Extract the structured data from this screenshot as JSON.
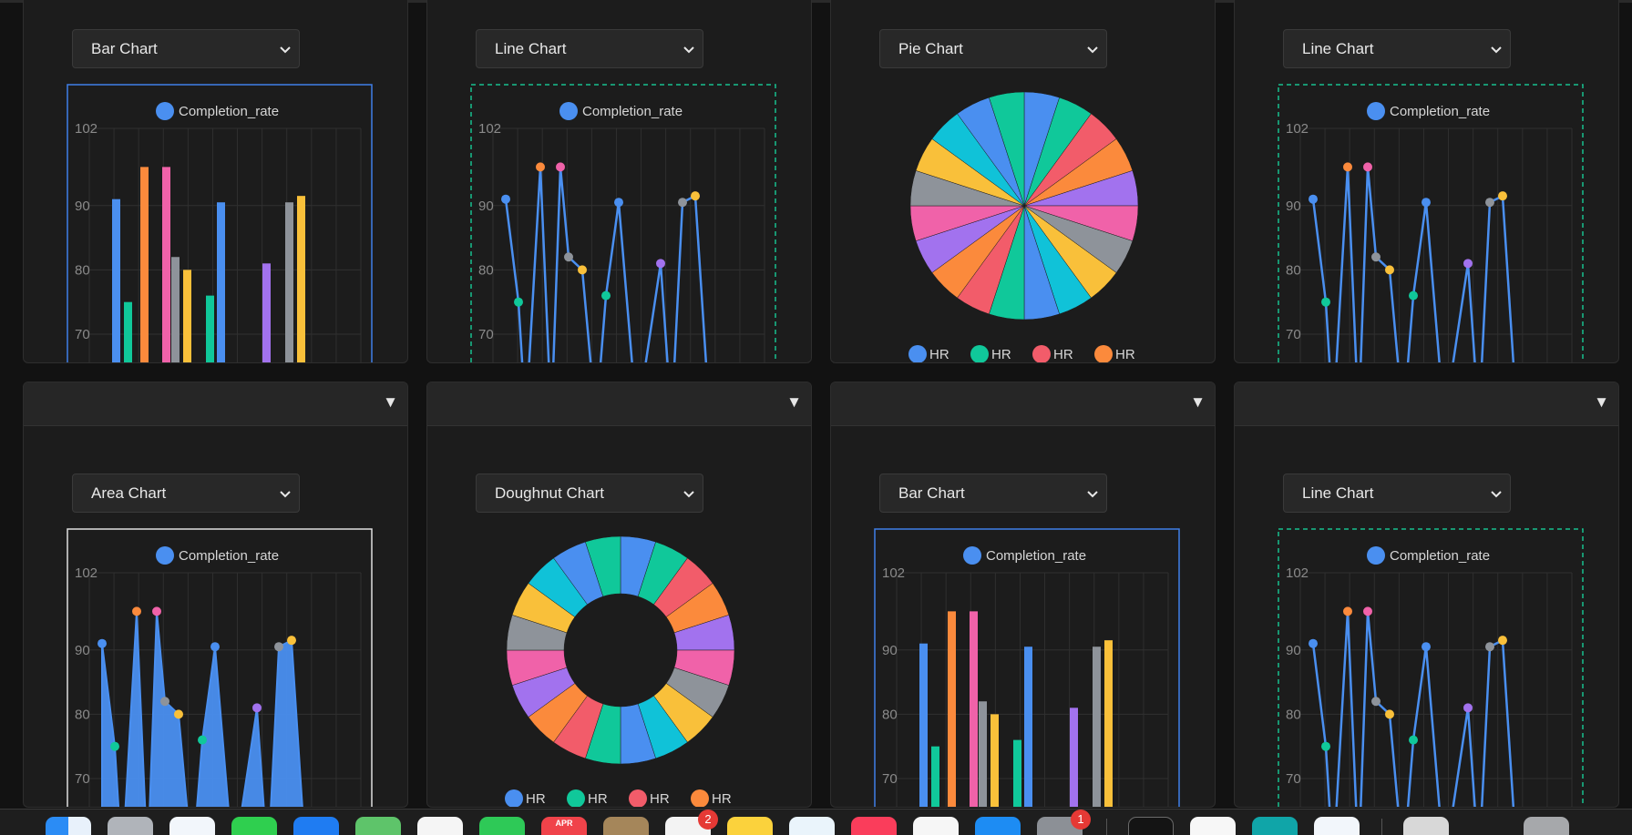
{
  "colors": {
    "blue": "#4a8ff0",
    "teal": "#10c89a",
    "red": "#f25c6a",
    "orange": "#fb8a3c",
    "pink": "#f062a9",
    "gray": "#8e939a",
    "yellow": "#f9c03a",
    "cyan": "#10c2d8",
    "purple": "#a272ee"
  },
  "panels": [
    {
      "chart_type_label": "Bar Chart",
      "collapse_arrow": ""
    },
    {
      "chart_type_label": "Line Chart",
      "collapse_arrow": ""
    },
    {
      "chart_type_label": "Pie Chart",
      "collapse_arrow": ""
    },
    {
      "chart_type_label": "Line Chart",
      "collapse_arrow": ""
    },
    {
      "chart_type_label": "Area Chart",
      "collapse_arrow": "▼"
    },
    {
      "chart_type_label": "Doughnut Chart",
      "collapse_arrow": "▼"
    },
    {
      "chart_type_label": "Bar Chart",
      "collapse_arrow": "▼"
    },
    {
      "chart_type_label": "Line Chart",
      "collapse_arrow": "▼"
    }
  ],
  "chart_data": [
    {
      "type": "bar",
      "series": [
        {
          "name": "Completion_rate",
          "values": [
            91,
            75,
            96,
            96,
            82,
            80,
            76,
            90.5,
            81,
            90.5,
            91.5
          ]
        }
      ],
      "legend": "top",
      "y_ticks": [
        102,
        90,
        80,
        70
      ],
      "ylim": [
        66,
        104
      ]
    },
    {
      "type": "line",
      "series": [
        {
          "name": "Completion_rate",
          "values": [
            91,
            75,
            96,
            96,
            82,
            80,
            76,
            90.5,
            81,
            90.5,
            91.5
          ]
        }
      ],
      "legend": "top",
      "y_ticks": [
        102,
        90,
        80,
        70
      ],
      "ylim": [
        66,
        104
      ]
    },
    {
      "type": "pie",
      "categories": [
        "HR",
        "HR",
        "HR",
        "HR"
      ],
      "legend": "bottom"
    },
    {
      "type": "line",
      "series": [
        {
          "name": "Completion_rate",
          "values": [
            91,
            75,
            96,
            96,
            82,
            80,
            76,
            90.5,
            81,
            90.5,
            91.5
          ]
        }
      ],
      "legend": "top",
      "y_ticks": [
        102,
        90,
        80,
        70
      ],
      "ylim": [
        66,
        104
      ]
    },
    {
      "type": "area",
      "series": [
        {
          "name": "Completion_rate",
          "values": [
            91,
            75,
            96,
            96,
            82,
            80,
            76,
            90.5,
            81,
            90.5,
            91.5
          ]
        }
      ],
      "legend": "top",
      "y_ticks": [
        102,
        90,
        80,
        70
      ],
      "ylim": [
        66,
        104
      ]
    },
    {
      "type": "doughnut",
      "categories": [
        "HR",
        "HR",
        "HR",
        "HR"
      ],
      "legend": "bottom"
    },
    {
      "type": "bar",
      "series": [
        {
          "name": "Completion_rate",
          "values": [
            91,
            75,
            96,
            96,
            82,
            80,
            76,
            90.5,
            81,
            90.5,
            91.5
          ]
        }
      ],
      "legend": "top",
      "y_ticks": [
        102,
        90,
        80,
        70
      ],
      "ylim": [
        66,
        104
      ]
    },
    {
      "type": "line",
      "series": [
        {
          "name": "Completion_rate",
          "values": [
            91,
            75,
            96,
            96,
            82,
            80,
            76,
            90.5,
            81,
            90.5,
            91.5
          ]
        }
      ],
      "legend": "top",
      "y_ticks": [
        102,
        90,
        80,
        70
      ],
      "ylim": [
        66,
        104
      ]
    }
  ],
  "dock": {
    "calendar_month": "APR",
    "badge_1": "2",
    "badge_2": "1",
    "icons": [
      "finder-icon",
      "launchpad-icon",
      "safari-icon",
      "messages-icon",
      "mail-icon",
      "maps-icon",
      "photos-icon",
      "facetime-icon",
      "calendar-icon",
      "notes-app-icon",
      "reminders-icon",
      "stickies-icon",
      "freeform-icon",
      "music-icon",
      "news-icon",
      "app-store-icon",
      "settings-icon",
      "terminal-icon",
      "textedit-icon",
      "browser-icon",
      "vpn-icon",
      "downloads-icon",
      "trash-icon"
    ]
  }
}
